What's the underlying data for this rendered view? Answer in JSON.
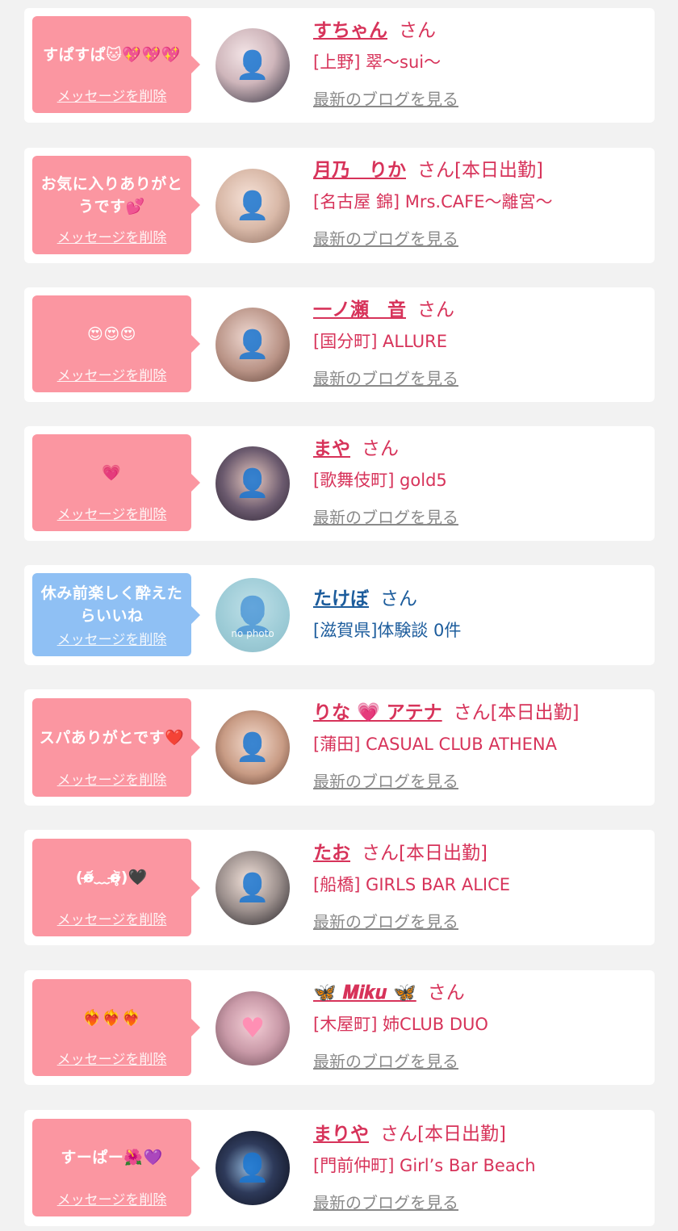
{
  "common": {
    "delete_label": "メッセージを削除",
    "blog_label": "最新のブログを見る",
    "san": "さん"
  },
  "colors": {
    "background": "#f2f2f2",
    "card": "#ffffff",
    "bubble_pink": "#fb96a1",
    "bubble_blue": "#8fc0f4",
    "name_pink": "#d7335a",
    "name_blue": "#1c5c9c",
    "blog_gray": "#8a8a8a"
  },
  "entries": [
    {
      "message": "すぱすぱ🐱💖💖💖",
      "name": "すちゃん",
      "suffix": "さん",
      "shop": "[上野] 翠〜sui〜",
      "blog": true,
      "theme": "pink",
      "avatar_icon": "woman-photo"
    },
    {
      "message": "お気に入りありがとうです💕",
      "name": "月乃　りか",
      "suffix": "さん[本日出勤]",
      "shop": "[名古屋 錦] Mrs.CAFE〜離宮〜",
      "blog": true,
      "theme": "pink",
      "avatar_icon": "woman-photo"
    },
    {
      "message": "😍😍😍",
      "name": "一ノ瀬　音",
      "suffix": "さん",
      "shop": "[国分町] ALLURE",
      "blog": true,
      "theme": "pink",
      "avatar_icon": "woman-photo"
    },
    {
      "message": "💗",
      "name": "まや",
      "suffix": "さん",
      "shop": "[歌舞伎町] gold5",
      "blog": true,
      "theme": "pink",
      "avatar_icon": "woman-photo"
    },
    {
      "message": "休み前楽しく酔えたらいいね",
      "name": "たけぼ",
      "suffix": "さん",
      "shop": "[滋賀県]体験談 0件",
      "blog": false,
      "theme": "blue",
      "avatar_icon": "no-photo-silhouette",
      "avatar_text": "no photo"
    },
    {
      "message": "スパありがとです❤️",
      "name": "りな 💗 アテナ",
      "suffix": "さん[本日出勤]",
      "shop": "[蒲田] CASUAL CLUB ATHENA",
      "blog": true,
      "theme": "pink",
      "avatar_icon": "woman-photo"
    },
    {
      "message": "(o̴̶̷᷄﹏o̴̶̷̥᷅)🖤",
      "name": "たお",
      "suffix": "さん[本日出勤]",
      "shop": "[船橋] GIRLS BAR ALICE",
      "blog": true,
      "theme": "pink",
      "avatar_icon": "woman-photo"
    },
    {
      "message": "❤️‍🔥❤️‍🔥❤️‍🔥",
      "name": "🦋 𝑴𝒊𝒌𝒖 🦋",
      "suffix": "さん",
      "shop": "[木屋町] 姉CLUB DUO",
      "blog": true,
      "theme": "pink",
      "avatar_icon": "woman-photo"
    },
    {
      "message": "すーぱー🌺💜",
      "name": "まりや",
      "suffix": "さん[本日出勤]",
      "shop": "[門前仲町] Girl’s Bar Beach",
      "blog": true,
      "theme": "pink",
      "avatar_icon": "woman-photo"
    }
  ]
}
